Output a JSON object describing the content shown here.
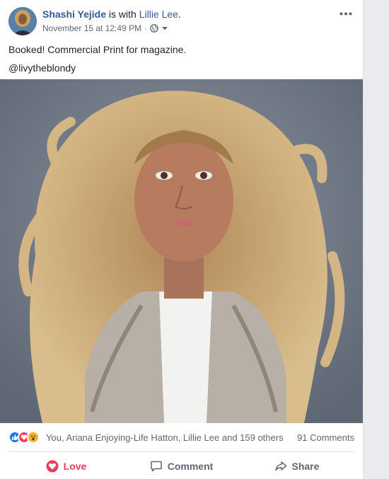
{
  "post": {
    "author": "Shashi Yejide",
    "with_prefix": "is with",
    "with_name": "Lillie Lee",
    "with_suffix": ".",
    "timestamp": "November 15 at 12:49 PM",
    "separator": "·",
    "text_lines": [
      "Booked! Commercial Print for magazine.",
      "@livytheblondy"
    ]
  },
  "reactions": {
    "icons": [
      "like-icon",
      "love-icon",
      "wow-icon"
    ],
    "summary": "You, Ariana Enjoying-Life Hatton, Lillie Lee and 159 others",
    "comments": "91 Comments"
  },
  "actions": {
    "love": "Love",
    "comment": "Comment",
    "share": "Share"
  },
  "colors": {
    "link": "#365899",
    "love": "#e63e5c",
    "muted": "#606770"
  }
}
